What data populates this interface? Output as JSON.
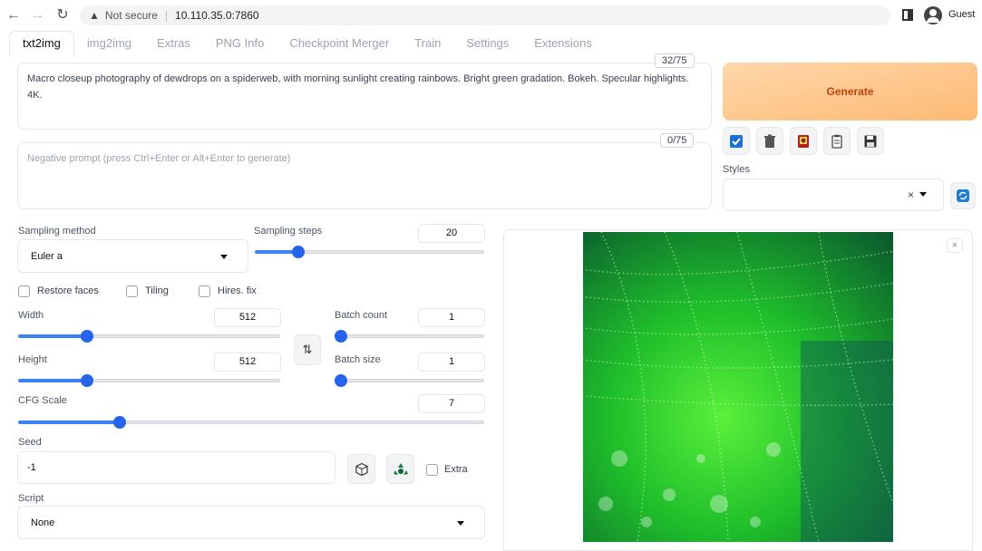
{
  "browser": {
    "security_label": "Not secure",
    "url": "10.110.35.0:7860",
    "profile_label": "Guest"
  },
  "tabs": [
    {
      "label": "txt2img",
      "active": true
    },
    {
      "label": "img2img"
    },
    {
      "label": "Extras"
    },
    {
      "label": "PNG Info"
    },
    {
      "label": "Checkpoint Merger"
    },
    {
      "label": "Train"
    },
    {
      "label": "Settings"
    },
    {
      "label": "Extensions"
    }
  ],
  "prompt": {
    "text": "Macro closeup photography of dewdrops on a spiderweb, with morning sunlight creating rainbows. Bright green gradation. Bokeh. Specular highlights. 4K.",
    "token_count": "32/75"
  },
  "negative_prompt": {
    "placeholder": "Negative prompt (press Ctrl+Enter or Alt+Enter to generate)",
    "token_count": "0/75"
  },
  "generate": {
    "label": "Generate"
  },
  "tool_icons": [
    "checkbox-icon",
    "trash-icon",
    "extra-networks-icon",
    "paste-icon",
    "save-icon"
  ],
  "styles": {
    "label": "Styles",
    "value": "",
    "clear": "×"
  },
  "sampling": {
    "method_label": "Sampling method",
    "method_value": "Euler a",
    "steps_label": "Sampling steps",
    "steps_value": "20",
    "steps_fraction": 0.17
  },
  "options": {
    "restore_faces": "Restore faces",
    "tiling": "Tiling",
    "hires_fix": "Hires. fix"
  },
  "width": {
    "label": "Width",
    "value": "512",
    "fraction": 0.25
  },
  "height": {
    "label": "Height",
    "value": "512",
    "fraction": 0.25
  },
  "batch_count": {
    "label": "Batch count",
    "value": "1",
    "fraction": 0.0
  },
  "batch_size": {
    "label": "Batch size",
    "value": "1",
    "fraction": 0.0
  },
  "cfg_scale": {
    "label": "CFG Scale",
    "value": "7",
    "fraction": 0.21
  },
  "seed": {
    "label": "Seed",
    "value": "-1",
    "extra_label": "Extra"
  },
  "script": {
    "label": "Script",
    "value": "None"
  },
  "colors": {
    "accent": "#2563eb",
    "generate_bg": "#fdba74",
    "generate_text": "#c2410c"
  }
}
